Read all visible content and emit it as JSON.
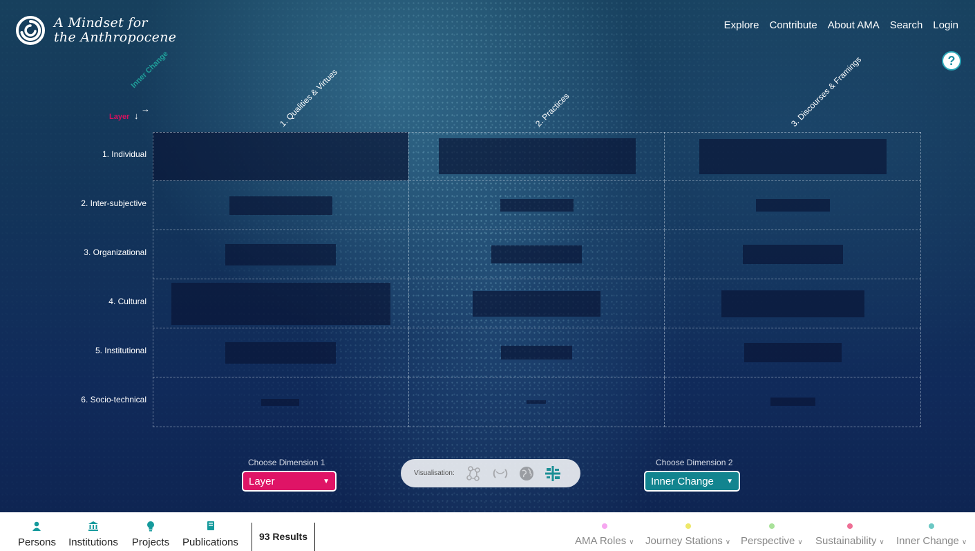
{
  "brand": {
    "line1": "A Mindset for",
    "line2": "the Anthropocene"
  },
  "nav": {
    "explore": "Explore",
    "contribute": "Contribute",
    "about": "About AMA",
    "search": "Search",
    "login": "Login"
  },
  "help": "?",
  "axes": {
    "row_axis": "Layer",
    "row_arrow": "↓",
    "col_axis": "Inner Change",
    "col_arrow": "→"
  },
  "columns": [
    "1. Qualities & Virtues",
    "2. Practices",
    "3. Discourses & Framings"
  ],
  "rows": [
    "1. Individual",
    "2. Inter-subjective",
    "3. Organizational",
    "4. Cultural",
    "5. Institutional",
    "6. Socio-technical"
  ],
  "controls": {
    "dim1_label": "Choose Dimension 1",
    "dim1_value": "Layer",
    "dim2_label": "Choose Dimension 2",
    "dim2_value": "Inner Change",
    "vis_label": "Visualisation:",
    "vis_icons": [
      "network-icon",
      "chord-icon",
      "globe-icon",
      "matrix-icon"
    ]
  },
  "footer": {
    "tabs": [
      {
        "label": "Persons",
        "icon": "person-icon"
      },
      {
        "label": "Institutions",
        "icon": "institution-icon"
      },
      {
        "label": "Projects",
        "icon": "lightbulb-icon"
      },
      {
        "label": "Publications",
        "icon": "book-icon"
      }
    ],
    "results": "93 Results",
    "filters": [
      {
        "label": "AMA Roles",
        "color": "#f6a7f0"
      },
      {
        "label": "Journey Stations",
        "color": "#eee86a"
      },
      {
        "label": "Perspective",
        "color": "#a9e29a"
      },
      {
        "label": "Sustainability",
        "color": "#ee6f95"
      },
      {
        "label": "Inner Change",
        "color": "#6cc8c4"
      }
    ]
  },
  "colors": {
    "dim1": "#df1466",
    "dim2": "#12848f",
    "accent": "#159a9c"
  }
}
